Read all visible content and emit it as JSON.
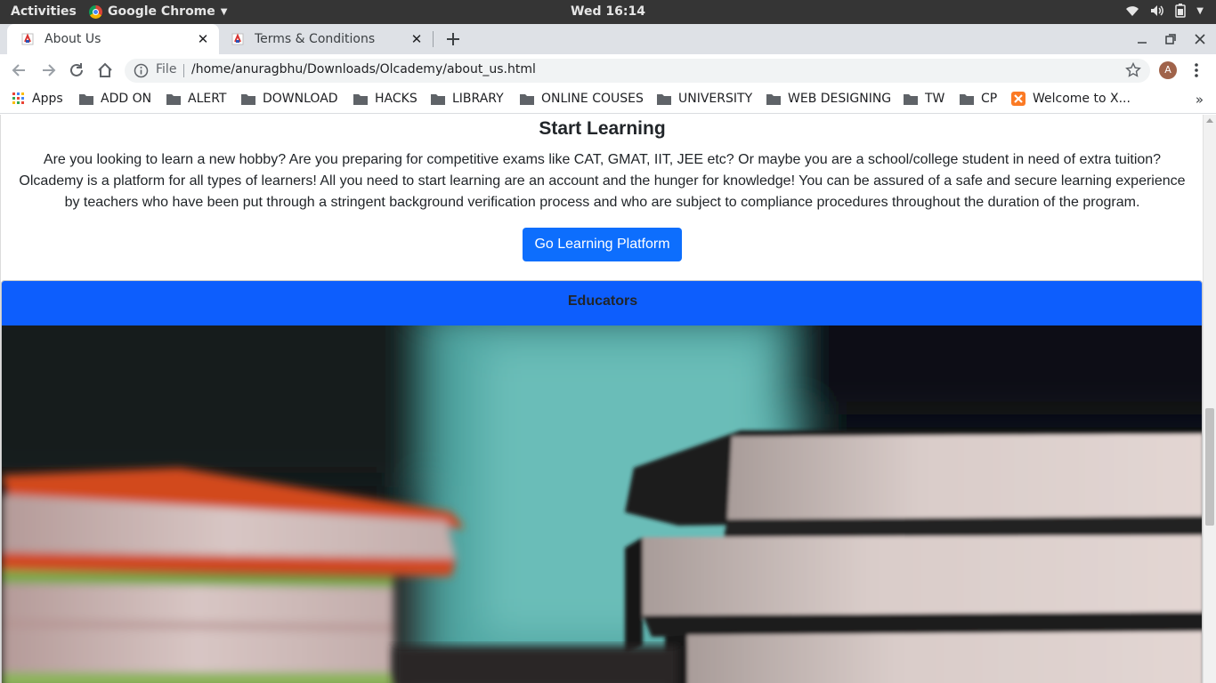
{
  "system_bar": {
    "activities": "Activities",
    "app_name": "Google Chrome",
    "clock": "Wed 16:14"
  },
  "tabs": [
    {
      "label": "About Us",
      "active": true
    },
    {
      "label": "Terms & Conditions",
      "active": false
    }
  ],
  "omnibox": {
    "scheme_label": "File",
    "url": "/home/anuragbhu/Downloads/Olcademy/about_us.html"
  },
  "profile": {
    "initial": "A"
  },
  "bookmarks": [
    {
      "label": "Apps",
      "icon": "apps-grid-icon"
    },
    {
      "label": "ADD ON",
      "icon": "folder-icon"
    },
    {
      "label": "ALERT",
      "icon": "folder-icon"
    },
    {
      "label": "DOWNLOAD",
      "icon": "folder-icon"
    },
    {
      "label": "HACKS",
      "icon": "folder-icon"
    },
    {
      "label": "LIBRARY",
      "icon": "folder-icon"
    },
    {
      "label": "ONLINE COUSES",
      "icon": "folder-icon"
    },
    {
      "label": "UNIVERSITY",
      "icon": "folder-icon"
    },
    {
      "label": "WEB DESIGNING",
      "icon": "folder-icon"
    },
    {
      "label": "TW",
      "icon": "folder-icon"
    },
    {
      "label": "CP",
      "icon": "folder-icon"
    },
    {
      "label": "Welcome to X...",
      "icon": "xampp-icon"
    }
  ],
  "page": {
    "heading": "Start Learning",
    "paragraph": "Are you looking to learn a new hobby? Are you preparing for competitive exams like CAT, GMAT, IIT, JEE etc? Or maybe you are a school/college student in need of extra tuition? Olcademy is a platform for all types of learners! All you need to start learning are an account and the hunger for knowledge! You can be assured of a safe and secure learning experience by teachers who have been put through a stringent background verification process and who are subject to compliance procedures throughout the duration of the program.",
    "button_label": "Go Learning Platform",
    "educators_title": "Educators"
  },
  "colors": {
    "primary_button": "#0d6efd",
    "educators_header": "#0d5efd"
  }
}
